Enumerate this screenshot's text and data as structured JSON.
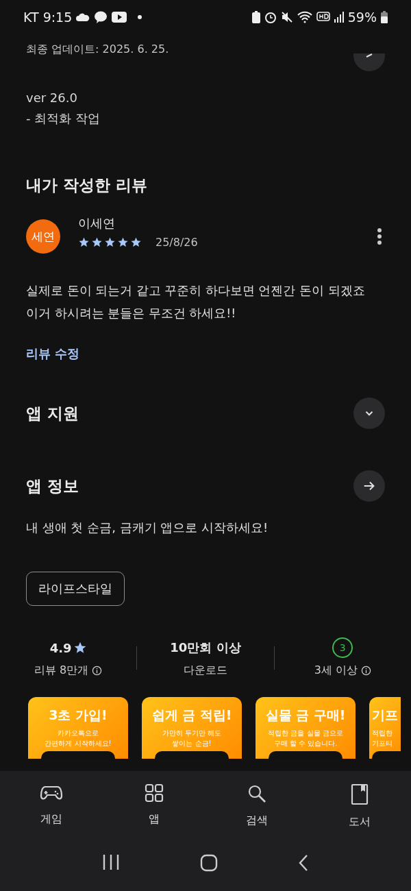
{
  "status_bar": {
    "carrier_time": "KT 9:15",
    "battery": "59%"
  },
  "update": {
    "last_updated": "최종 업데이트: 2025. 6. 25.",
    "notes": [
      "ver 26.0",
      "- 최적화 작업"
    ]
  },
  "my_review": {
    "title": "내가 작성한 리뷰",
    "avatar": "세연",
    "author": "이세연",
    "stars": 5,
    "date": "25/8/26",
    "text": "실제로 돈이 되는거 같고 꾸준히 하다보면 언젠간 돈이 되겠죠\n이거 하시려는 분들은 무조건 하세요!!",
    "edit_link": "리뷰 수정"
  },
  "app_support": {
    "title": "앱 지원",
    "expanded": false
  },
  "app_info": {
    "title": "앱 정보",
    "description": "내 생애 첫 순금, 금캐기 앱으로 시작하세요!",
    "category": "라이프스타일"
  },
  "stats": [
    {
      "kind": "rating",
      "value": "4.9",
      "label": "리뷰 8만개"
    },
    {
      "kind": "downloads",
      "value": "10만회 이상",
      "label": "다운로드"
    },
    {
      "kind": "age",
      "value": "3",
      "label": "3세 이상"
    }
  ],
  "screenshots": [
    {
      "title": "3초 가입!",
      "lines": [
        "카카오톡으로",
        "간편하게 시작하세요!"
      ]
    },
    {
      "title": "쉽게 금 적립!",
      "lines": [
        "가만히 두기만 해도",
        "쌓이는 순금!"
      ]
    },
    {
      "title": "실물 금 구매!",
      "lines": [
        "적립한 금을 실물 금으로",
        "구매 할 수 있습니다."
      ]
    },
    {
      "kind": "cut",
      "title": "기프",
      "lines": [
        "적립한",
        "기프티"
      ]
    }
  ],
  "bottom_nav": [
    {
      "kind": "games",
      "label": "게임"
    },
    {
      "kind": "apps",
      "label": "앱"
    },
    {
      "kind": "search",
      "label": "검색"
    },
    {
      "kind": "books",
      "label": "도서"
    }
  ]
}
